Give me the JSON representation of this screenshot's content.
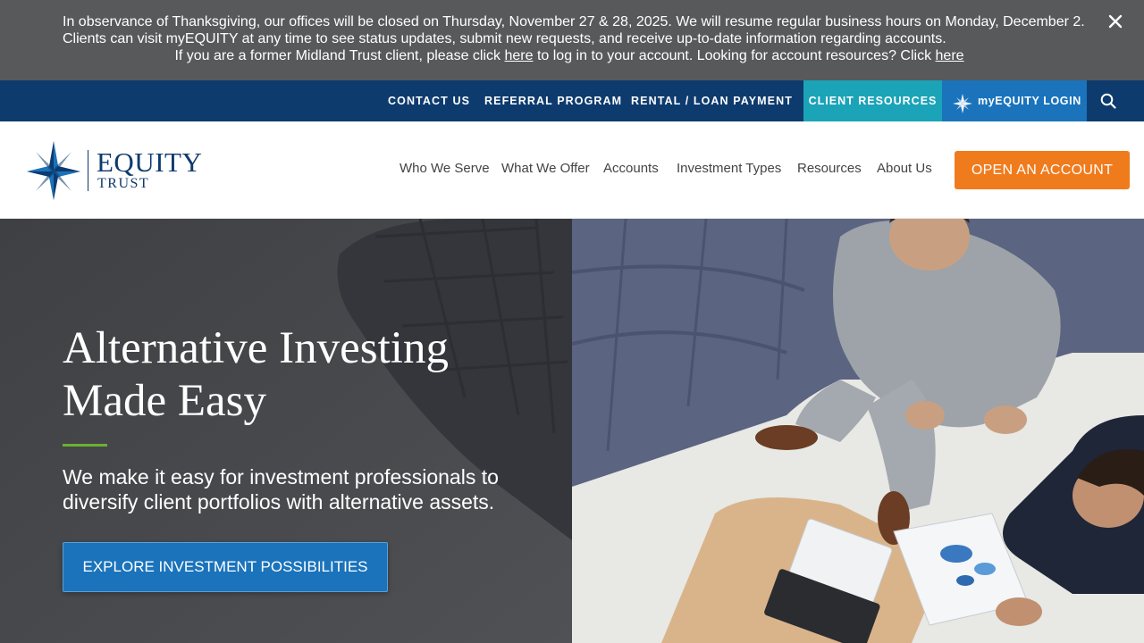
{
  "announcement": {
    "line1": "In observance of Thanksgiving, our offices will be closed on Thursday, November 27 & 28, 2025. We will resume regular business hours on Monday, December 2.",
    "line2": "Clients can visit myEQUITY at any time to see status updates, submit new requests, and receive up-to-date information regarding accounts.",
    "line3_before": "If you are a former Midland Trust client, please click ",
    "line3_link1": "here",
    "line3_middle": " to log in to your account. Looking for account resources? Click ",
    "line3_link2": "here",
    "close_icon": "close-icon"
  },
  "utility_nav": {
    "contact": "CONTACT US",
    "referral": "REFERRAL PROGRAM",
    "rental": "RENTAL / LOAN PAYMENT",
    "client_resources": "CLIENT RESOURCES",
    "login": "myEQUITY LOGIN",
    "search_icon": "search-icon"
  },
  "logo": {
    "name": "EQUITY",
    "sub": "TRUST"
  },
  "main_nav": {
    "who": "Who We Serve",
    "what": "What We Offer",
    "accounts": "Accounts",
    "investment": "Investment Types",
    "resources": "Resources",
    "about": "About Us"
  },
  "open_account": "OPEN AN ACCOUNT",
  "hero": {
    "title_line1": "Alternative Investing",
    "title_line2": "Made Easy",
    "lead": "We make it easy for investment professionals to diversify client portfolios with alternative assets.",
    "cta": "EXPLORE INVESTMENT POSSIBILITIES"
  },
  "colors": {
    "announcement_bg": "#58595b",
    "utility_bg": "#0d3b6e",
    "client_resources_bg": "#1ba3b8",
    "login_bg": "#1a73bb",
    "accent_orange": "#f07b1d",
    "accent_green": "#6bb22e",
    "hero_left_bg": "#4a4b4e"
  }
}
